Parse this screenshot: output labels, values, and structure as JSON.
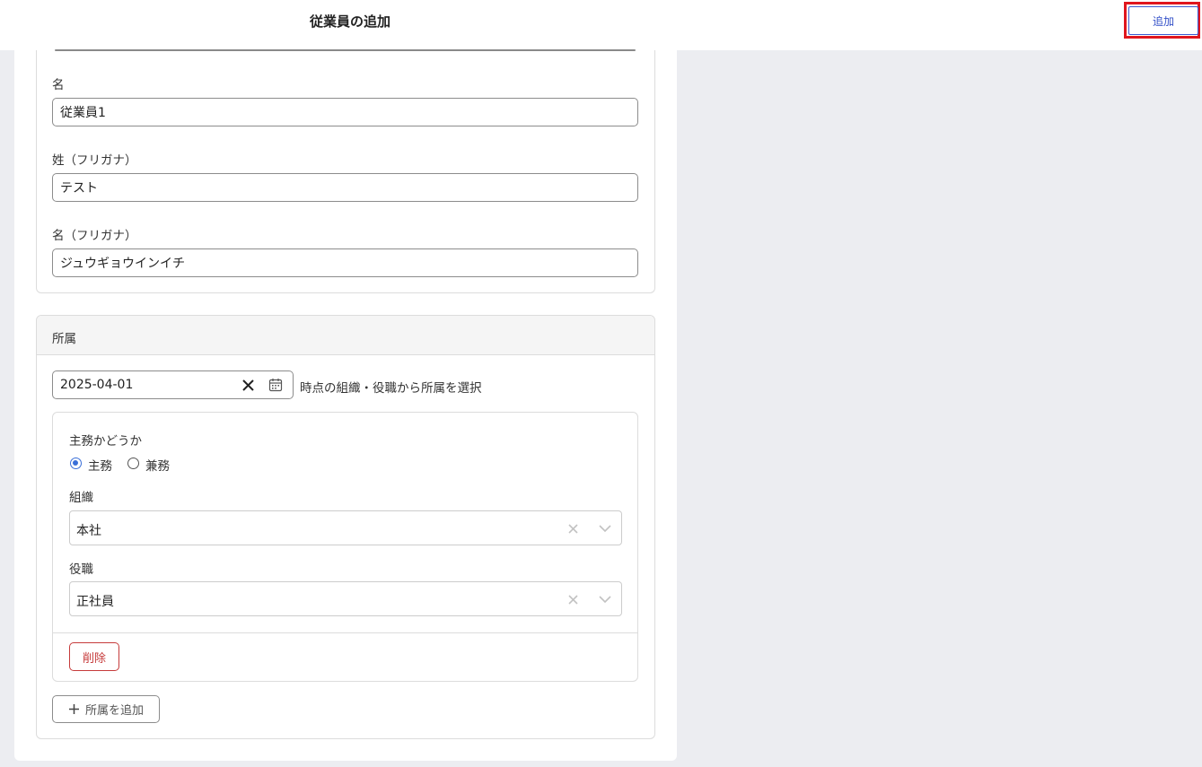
{
  "header": {
    "title": "従業員の追加",
    "add_button": "追加"
  },
  "basic_info": {
    "first_name_label": "名",
    "first_name_value": "従業員1",
    "last_kana_label": "姓（フリガナ）",
    "last_kana_value": "テスト",
    "first_kana_label": "名（フリガナ）",
    "first_kana_value": "ジュウギョウインイチ"
  },
  "affiliation": {
    "section_title": "所属",
    "date_value": "2025-04-01",
    "date_suffix": "時点の組織・役職から所属を選択",
    "main_question": "主務かどうか",
    "option_main": "主務",
    "option_concurrent": "兼務",
    "selected_option": "主務",
    "org_label": "組織",
    "org_value": "本社",
    "position_label": "役職",
    "position_value": "正社員",
    "delete_button": "削除",
    "add_affiliation_button": "所属を追加"
  },
  "colors": {
    "highlight": "#e0161e",
    "primary": "#3350c8",
    "danger": "#c63b3b",
    "radio_checked": "#3a6fd8"
  }
}
